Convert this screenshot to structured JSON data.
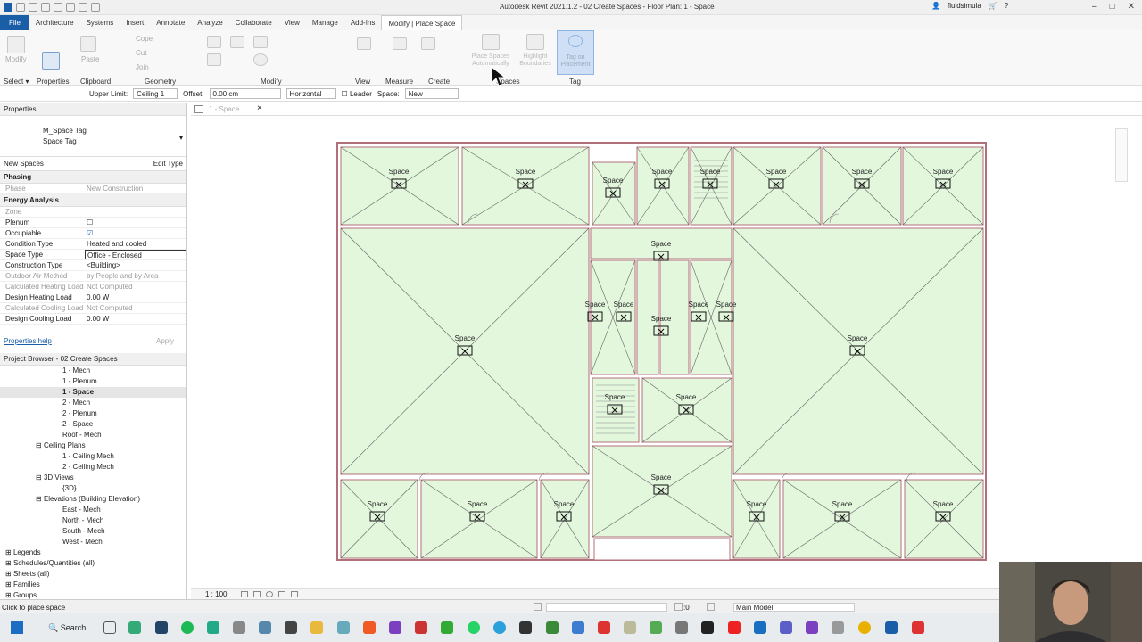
{
  "window": {
    "title": "Autodesk Revit 2021.1.2 - 02 Create Spaces - Floor Plan: 1 - Space",
    "user": "fluidsimula"
  },
  "tabs": [
    "File",
    "Architecture",
    "Systems",
    "Insert",
    "Annotate",
    "Analyze",
    "Collaborate",
    "View",
    "Manage",
    "Add-Ins",
    "Modify | Place Space"
  ],
  "ribbon": {
    "panels": [
      "Select",
      "Properties",
      "Clipboard",
      "Geometry",
      "Modify",
      "View",
      "Measure",
      "Create",
      "Spaces",
      "Tag"
    ],
    "buttons": {
      "modify": "Modify",
      "properties": "Properties",
      "paste": "Paste",
      "cope": "Cope",
      "cut": "Cut",
      "join": "Join",
      "place_spaces": "Place Spaces Automatically",
      "highlight": "Highlight Boundaries",
      "tag": "Tag on Placement"
    }
  },
  "options_bar": {
    "upper_limit_label": "Upper Limit:",
    "upper_limit_value": "Ceiling 1",
    "offset_label": "Offset:",
    "offset_value": "0.00 cm",
    "orientation": "Horizontal",
    "leader": "Leader",
    "space_label": "Space:",
    "space_value": "New"
  },
  "properties": {
    "header": "Properties",
    "type_name": "M_Space Tag",
    "type_sub": "Space Tag",
    "filter": "New Spaces",
    "edit_type": "Edit Type",
    "groups": [
      {
        "name": "Phasing",
        "rows": [
          {
            "k": "Phase",
            "v": "New Construction",
            "grey": true
          }
        ]
      },
      {
        "name": "Energy Analysis",
        "rows": [
          {
            "k": "Zone",
            "v": "",
            "grey": true
          },
          {
            "k": "Plenum",
            "v": "",
            "check": false
          },
          {
            "k": "Occupiable",
            "v": "",
            "check": true
          },
          {
            "k": "Condition Type",
            "v": "Heated and cooled"
          },
          {
            "k": "Space Type",
            "v": "Office - Enclosed",
            "boxed": true
          },
          {
            "k": "Construction Type",
            "v": "<Building>"
          },
          {
            "k": "Outdoor Air Method",
            "v": "by People and by Area",
            "grey": true
          },
          {
            "k": "Calculated Heating Load",
            "v": "Not Computed",
            "grey": true
          },
          {
            "k": "Design Heating Load",
            "v": "0.00 W"
          },
          {
            "k": "Calculated Cooling Load",
            "v": "Not Computed",
            "grey": true
          },
          {
            "k": "Design Cooling Load",
            "v": "0.00 W"
          }
        ]
      }
    ],
    "help": "Properties help",
    "apply": "Apply"
  },
  "browser": {
    "title": "Project Browser - 02 Create Spaces",
    "items": [
      {
        "t": "1 - Mech",
        "l": 3
      },
      {
        "t": "1 - Plenum",
        "l": 3
      },
      {
        "t": "1 - Space",
        "l": 3,
        "bold": true
      },
      {
        "t": "2 - Mech",
        "l": 3
      },
      {
        "t": "2 - Plenum",
        "l": 3
      },
      {
        "t": "2 - Space",
        "l": 3
      },
      {
        "t": "Roof - Mech",
        "l": 3
      },
      {
        "t": "Ceiling Plans",
        "l": 2,
        "tog": "⊟"
      },
      {
        "t": "1 - Ceiling Mech",
        "l": 3
      },
      {
        "t": "2 - Ceiling Mech",
        "l": 3
      },
      {
        "t": "3D Views",
        "l": 2,
        "tog": "⊟"
      },
      {
        "t": "{3D}",
        "l": 3
      },
      {
        "t": "Elevations (Building Elevation)",
        "l": 2,
        "tog": "⊟"
      },
      {
        "t": "East - Mech",
        "l": 3
      },
      {
        "t": "North - Mech",
        "l": 3
      },
      {
        "t": "South - Mech",
        "l": 3
      },
      {
        "t": "West - Mech",
        "l": 3
      },
      {
        "t": "Legends",
        "l": 0,
        "tog": "⊞"
      },
      {
        "t": "Schedules/Quantities (all)",
        "l": 0,
        "tog": "⊞"
      },
      {
        "t": "Sheets (all)",
        "l": 0,
        "tog": "⊞"
      },
      {
        "t": "Families",
        "l": 0,
        "tog": "⊞"
      },
      {
        "t": "Groups",
        "l": 0,
        "tog": "⊞"
      }
    ]
  },
  "view_tab": "1 - Space",
  "space_label": "Space",
  "view_control": {
    "scale": "1 : 100"
  },
  "status": {
    "hint": "Click to place space",
    "coord": ":0",
    "model": "Main Model"
  },
  "taskbar": {
    "search": "Search"
  },
  "colors": {
    "space_fill": "#e3f7dd",
    "wall": "#b0707a",
    "accent": "#1b5ea8"
  }
}
